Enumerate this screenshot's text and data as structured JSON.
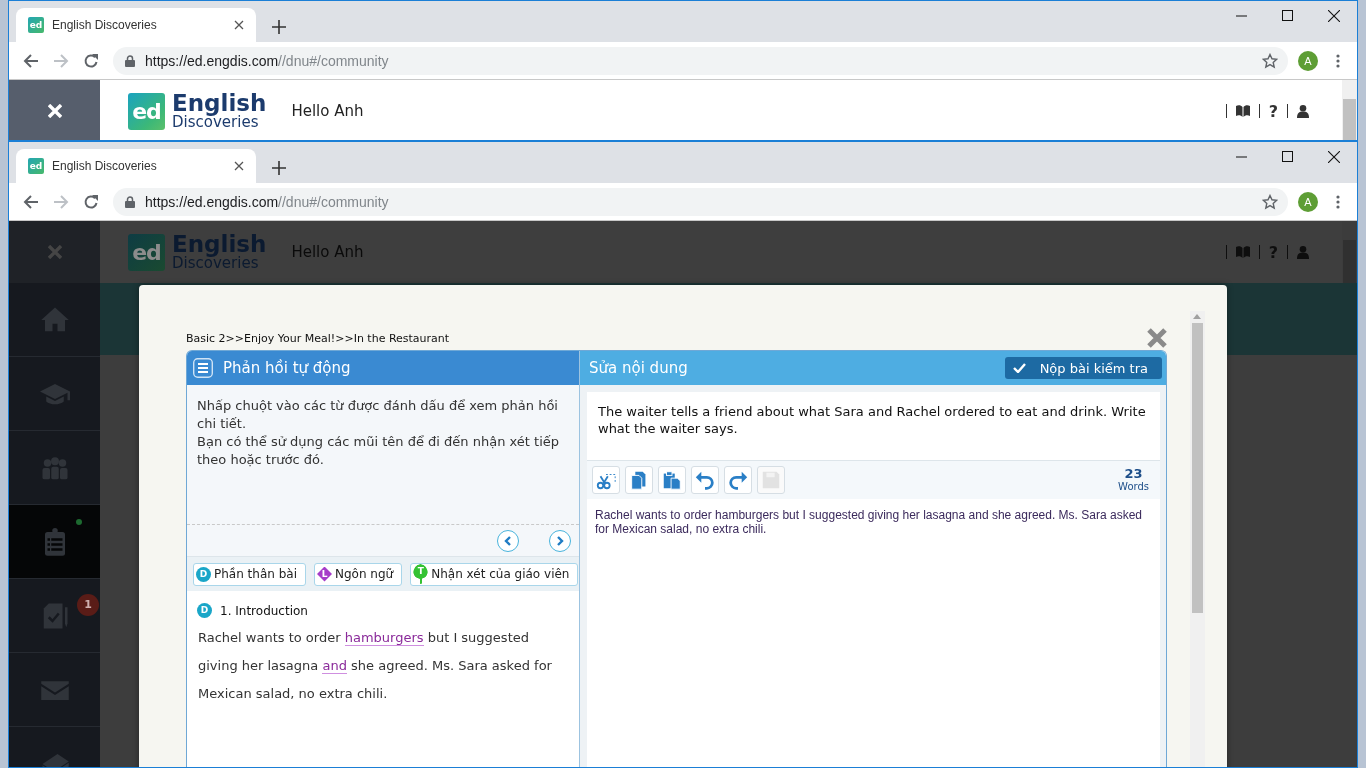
{
  "windows": [
    {
      "dimmed": false,
      "tab": {
        "favicon": "ed",
        "title": "English Discoveries"
      },
      "url": {
        "host": "https://ed.engdis.com",
        "path": "//dnu#/community"
      },
      "avatar": "A",
      "app": {
        "logo": {
          "mark": "ed",
          "line1": "English",
          "line2": "Discoveries"
        },
        "greeting": "Hello Anh",
        "help": "?"
      }
    },
    {
      "dimmed": true,
      "tab": {
        "favicon": "ed",
        "title": "English Discoveries"
      },
      "url": {
        "host": "https://ed.engdis.com",
        "path": "//dnu#/community"
      },
      "avatar": "A",
      "app": {
        "logo": {
          "mark": "ed",
          "line1": "English",
          "line2": "Discoveries"
        },
        "greeting": "Hello Anh",
        "help": "?"
      },
      "sidebar": {
        "items": [
          {
            "kind": "home",
            "selected": false,
            "dot": false
          },
          {
            "kind": "courses",
            "selected": false,
            "dot": false
          },
          {
            "kind": "community",
            "selected": false,
            "dot": false
          },
          {
            "kind": "tasks",
            "selected": true,
            "dot": true
          },
          {
            "kind": "assignments",
            "selected": false,
            "dot": false,
            "badge": "1"
          },
          {
            "kind": "messages",
            "selected": false,
            "dot": false
          },
          {
            "kind": "book",
            "selected": false,
            "dot": false
          }
        ]
      },
      "modal": {
        "breadcrumb": "Basic 2>>Enjoy Your Meal!>>In the Restaurant",
        "feedback": {
          "title": "Phản hồi tự động",
          "instructions": [
            "Nhấp chuột vào các từ được đánh dấu để xem phản hồi chi tiết.",
            "Bạn có thể sử dụng các mũi tên để đi đến nhận xét tiếp theo hoặc trước đó."
          ],
          "categories": [
            {
              "kind": "circle",
              "letter": "D",
              "label": "Phần thân bài",
              "color": "#1aa6c8"
            },
            {
              "kind": "diamond",
              "letter": "L",
              "label": "Ngôn ngữ",
              "color": "#a63cc9"
            },
            {
              "kind": "pin",
              "letter": "T",
              "label": "Nhận xét của giáo viên",
              "color": "#34c233"
            }
          ],
          "section": {
            "letter": "D",
            "title": "1. Introduction"
          },
          "essay": [
            {
              "text": "Rachel wants to order ",
              "highlighted": false
            },
            {
              "text": "hamburgers",
              "highlighted": true
            },
            {
              "text": " but I suggested giving her lasagna ",
              "highlighted": false
            },
            {
              "text": "and",
              "highlighted": true
            },
            {
              "text": " she agreed. Ms. Sara asked for Mexican salad, no extra chili.",
              "highlighted": false
            }
          ]
        },
        "editor": {
          "title": "Sửa nội dung",
          "submit": "Nộp bài kiểm tra",
          "prompt": "The waiter tells a friend about what Sara and Rachel ordered to eat and drink. Write what the waiter says.",
          "tools": [
            {
              "kind": "cut",
              "disabled": false
            },
            {
              "kind": "copy",
              "disabled": false
            },
            {
              "kind": "paste",
              "disabled": false
            },
            {
              "kind": "undo",
              "disabled": false
            },
            {
              "kind": "redo",
              "disabled": false
            },
            {
              "kind": "save",
              "disabled": true
            }
          ],
          "word_count": "23",
          "word_label": "Words",
          "text": "Rachel wants to order hamburgers but I suggested giving her lasagna and she agreed. Ms. Sara asked for Mexican salad, no extra chili."
        }
      }
    }
  ]
}
